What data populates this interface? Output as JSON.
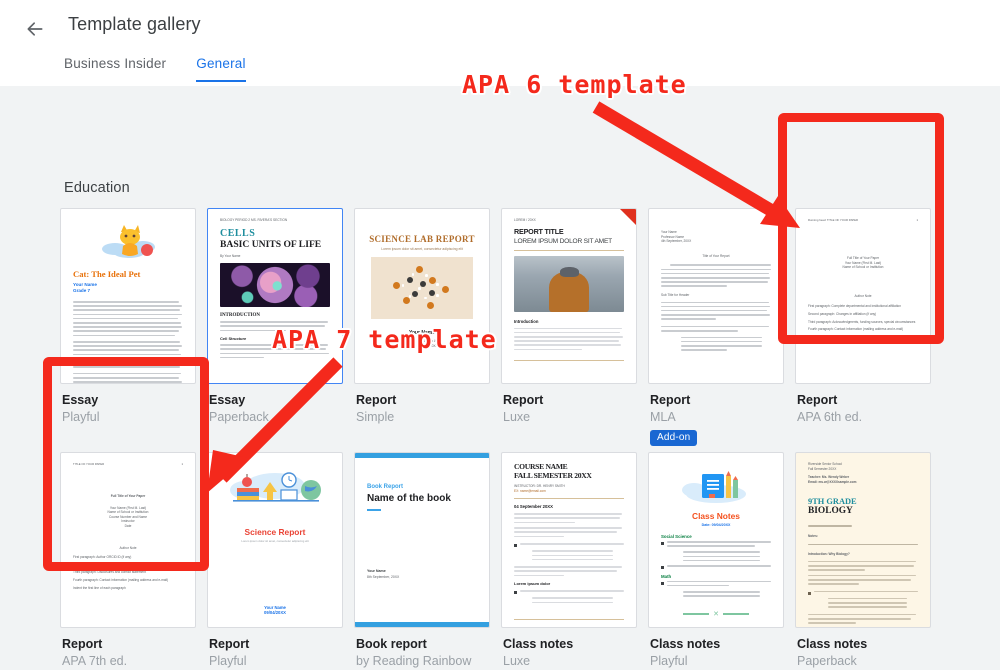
{
  "header": {
    "back_icon": "arrow-left-icon",
    "title": "Template gallery",
    "tabs": [
      {
        "label": "Business Insider",
        "active": false
      },
      {
        "label": "General",
        "active": true
      }
    ]
  },
  "section": {
    "title": "Education"
  },
  "colors": {
    "accent_blue": "#1a73e8",
    "annotation_red": "#f4291c",
    "badge_blue": "#1967d2",
    "page_bg": "#f1f3f4"
  },
  "templates": [
    {
      "name": "Essay",
      "sub": "Playful",
      "badge": null,
      "selected": false,
      "thumb": {
        "style": "playful-cat",
        "title": "Cat: The Ideal Pet",
        "line1": "Your Name",
        "line2": "Grade 7"
      }
    },
    {
      "name": "Essay",
      "sub": "Paperback",
      "badge": null,
      "selected": true,
      "thumb": {
        "style": "paperback-cells",
        "kicker": "BIOLOGY PERIOD 2\nMS. RIVERA'S SECTION",
        "title": "CELLS",
        "title2": "BASIC UNITS OF LIFE",
        "byline": "By Your Name",
        "heading1": "INTRODUCTION",
        "heading2": "Cell Structure"
      }
    },
    {
      "name": "Report",
      "sub": "Simple",
      "badge": null,
      "selected": false,
      "thumb": {
        "style": "simple-lab",
        "title": "SCIENCE LAB REPORT",
        "subtitle": "Lorem ipsum dolor sit amet, consectetur adipiscing elit",
        "author": "Your Name",
        "meta1": "Period 2 / Section A",
        "meta2": "17th November, 20XX"
      }
    },
    {
      "name": "Report",
      "sub": "Luxe",
      "badge": null,
      "selected": false,
      "thumb": {
        "style": "luxe-report",
        "kicker": "LOREM / 20XX",
        "title": "REPORT TITLE",
        "title2": "LOREM IPSUM DOLOR SIT AMET",
        "heading": "Introduction"
      }
    },
    {
      "name": "Report",
      "sub": "MLA",
      "badge": "Add-on",
      "selected": false,
      "thumb": {
        "style": "mla-report",
        "header_lines": [
          "Your Name",
          "Professor Name",
          "4th September, 20XX"
        ],
        "title": "Title of Your Report",
        "heading": "Sub Title for Header"
      }
    },
    {
      "name": "Report",
      "sub": "APA 6th ed.",
      "badge": null,
      "selected": false,
      "thumb": {
        "style": "apa-report",
        "running_head": "Running head: TITLE OF YOUR PAPER",
        "page_number": "1",
        "center_lines": [
          "Full Title of Your Paper",
          "Your Name (First M. Last)",
          "Name of School or Institution"
        ],
        "body_title": "Author Note",
        "body_lines": [
          "First paragraph: Complete departmental and institutional affiliation",
          "Second paragraph: Changes in affiliation (if any)",
          "Third paragraph: Acknowledgments, funding sources, special circumstances",
          "Fourth paragraph: Contact information (mailing address and e-mail)"
        ]
      }
    },
    {
      "name": "Report",
      "sub": "APA 7th ed.",
      "badge": null,
      "selected": false,
      "thumb": {
        "style": "apa7-report",
        "running_head": "TITLE OF YOUR PAPER",
        "page_number": "1",
        "center_lines": [
          "Full Title of Your Paper",
          "Your Name (First M. Last)",
          "Name of School or Institution",
          "Course Number and Name",
          "Instructor",
          "Date"
        ],
        "body_title": "Author Note",
        "body_lines": [
          "First paragraph: Author ORCID iD (if any)",
          "Second paragraph: Changes in affiliation (if any)",
          "Third paragraph: Disclosures and conflict statement",
          "Fourth paragraph: Contact information (mailing address and e-mail)",
          "Indent the first line of each paragraph"
        ]
      }
    },
    {
      "name": "Report",
      "sub": "Playful",
      "badge": null,
      "selected": false,
      "thumb": {
        "style": "playful-science",
        "title": "Science Report",
        "subtitle": "Lorem ipsum dolor sit amet, consectetur adipiscing elit",
        "author": "Your Name",
        "date": "09/04/20XX"
      }
    },
    {
      "name": "Book report",
      "sub": "by Reading Rainbow",
      "badge": null,
      "selected": false,
      "thumb": {
        "style": "book-report",
        "kicker": "Book Report",
        "title": "Name of the book",
        "author": "Your Name",
        "date": "8th September, 20XX"
      }
    },
    {
      "name": "Class notes",
      "sub": "Luxe",
      "badge": null,
      "selected": false,
      "thumb": {
        "style": "luxe-notes",
        "title": "COURSE NAME",
        "title2": "FALL SEMESTER 20XX",
        "meta1": "INSTRUCTOR: DR. HENRY SMITH",
        "meta2": "EX: name@email.com",
        "heading": "04 September 20XX",
        "heading2": "Lorem ipsum dolor"
      }
    },
    {
      "name": "Class notes",
      "sub": "Playful",
      "badge": null,
      "selected": false,
      "thumb": {
        "style": "playful-notes",
        "title": "Class Notes",
        "date": "Date: 09/04/20XX",
        "section1": "Social Science",
        "section2": "Math"
      }
    },
    {
      "name": "Class notes",
      "sub": "Paperback",
      "badge": null,
      "selected": false,
      "thumb": {
        "style": "paperback-notes",
        "kicker1": "Riverside Senior School",
        "kicker2": "Fall Semester 20XX",
        "kicker3": "Teacher: Ms. Wendy Weber",
        "kicker4": "Email: ms.w@XXXXsample.com",
        "title": "9TH GRADE",
        "title2": "BIOLOGY",
        "notes_label": "Notes:",
        "heading": "Introduction: Why Biology?"
      }
    }
  ],
  "annotations": [
    {
      "id": "apa6-label",
      "text": "APA 6 template"
    },
    {
      "id": "apa7-label",
      "text": "APA 7 template"
    }
  ]
}
